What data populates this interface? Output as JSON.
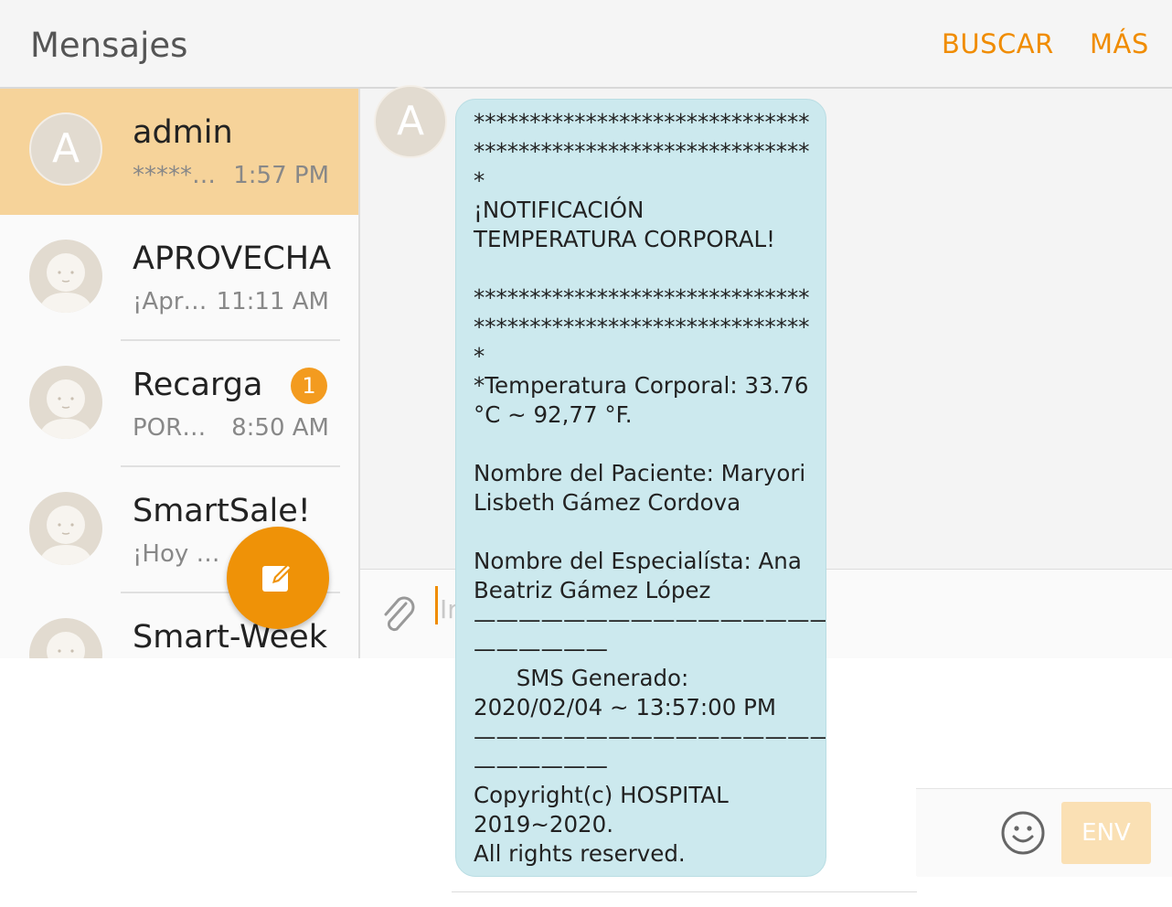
{
  "header": {
    "title": "Mensajes",
    "search_label": "BUSCAR",
    "more_label": "MÁS"
  },
  "conversations": [
    {
      "name": "admin",
      "snippet": "*******…",
      "time": "1:57 PM",
      "avatar_letter": "A",
      "selected": true
    },
    {
      "name": "APROVECHA",
      "snippet": "¡Apr…",
      "time": "11:11 AM"
    },
    {
      "name": "Recarga",
      "snippet": "POR…",
      "time": "8:50 AM",
      "unread": "1"
    },
    {
      "name": "SmartSale!",
      "snippet": "¡Hoy ulti…",
      "time": ""
    },
    {
      "name": "Smart-Week",
      "snippet": "",
      "time": ""
    }
  ],
  "thread": {
    "avatar_letter": "A",
    "message_lines": [
      "******************************",
      "******************************",
      "*",
      "¡NOTIFICACIÓN",
      "TEMPERATURA CORPORAL!",
      "",
      "******************************",
      "******************************",
      "*",
      "*Temperatura Corporal: 33.76",
      "°C ~ 92,77 °F.",
      "",
      "Nombre del Paciente: Maryori",
      "Lisbeth Gámez Cordova",
      "",
      "Nombre del Especialísta: Ana",
      "Beatriz Gámez López",
      "——————————————————",
      "——————",
      "      SMS Generado:",
      "2020/02/04 ~ 13:57:00 PM",
      "——————————————————",
      "——————",
      "Copyright(c) HOSPITAL",
      "2019~2020.",
      "All rights reserved."
    ]
  },
  "composer": {
    "input_hint": "Ir",
    "send_label": "ENV"
  },
  "icons": {
    "compose": "compose-icon",
    "attach": "paperclip-icon",
    "emoji": "smiley-icon",
    "contact": "person-avatar-icon"
  },
  "colors": {
    "accent": "#f08c00",
    "selected_row": "#f6d39a",
    "bubble": "#cce9ee",
    "badge": "#f39b1f"
  }
}
